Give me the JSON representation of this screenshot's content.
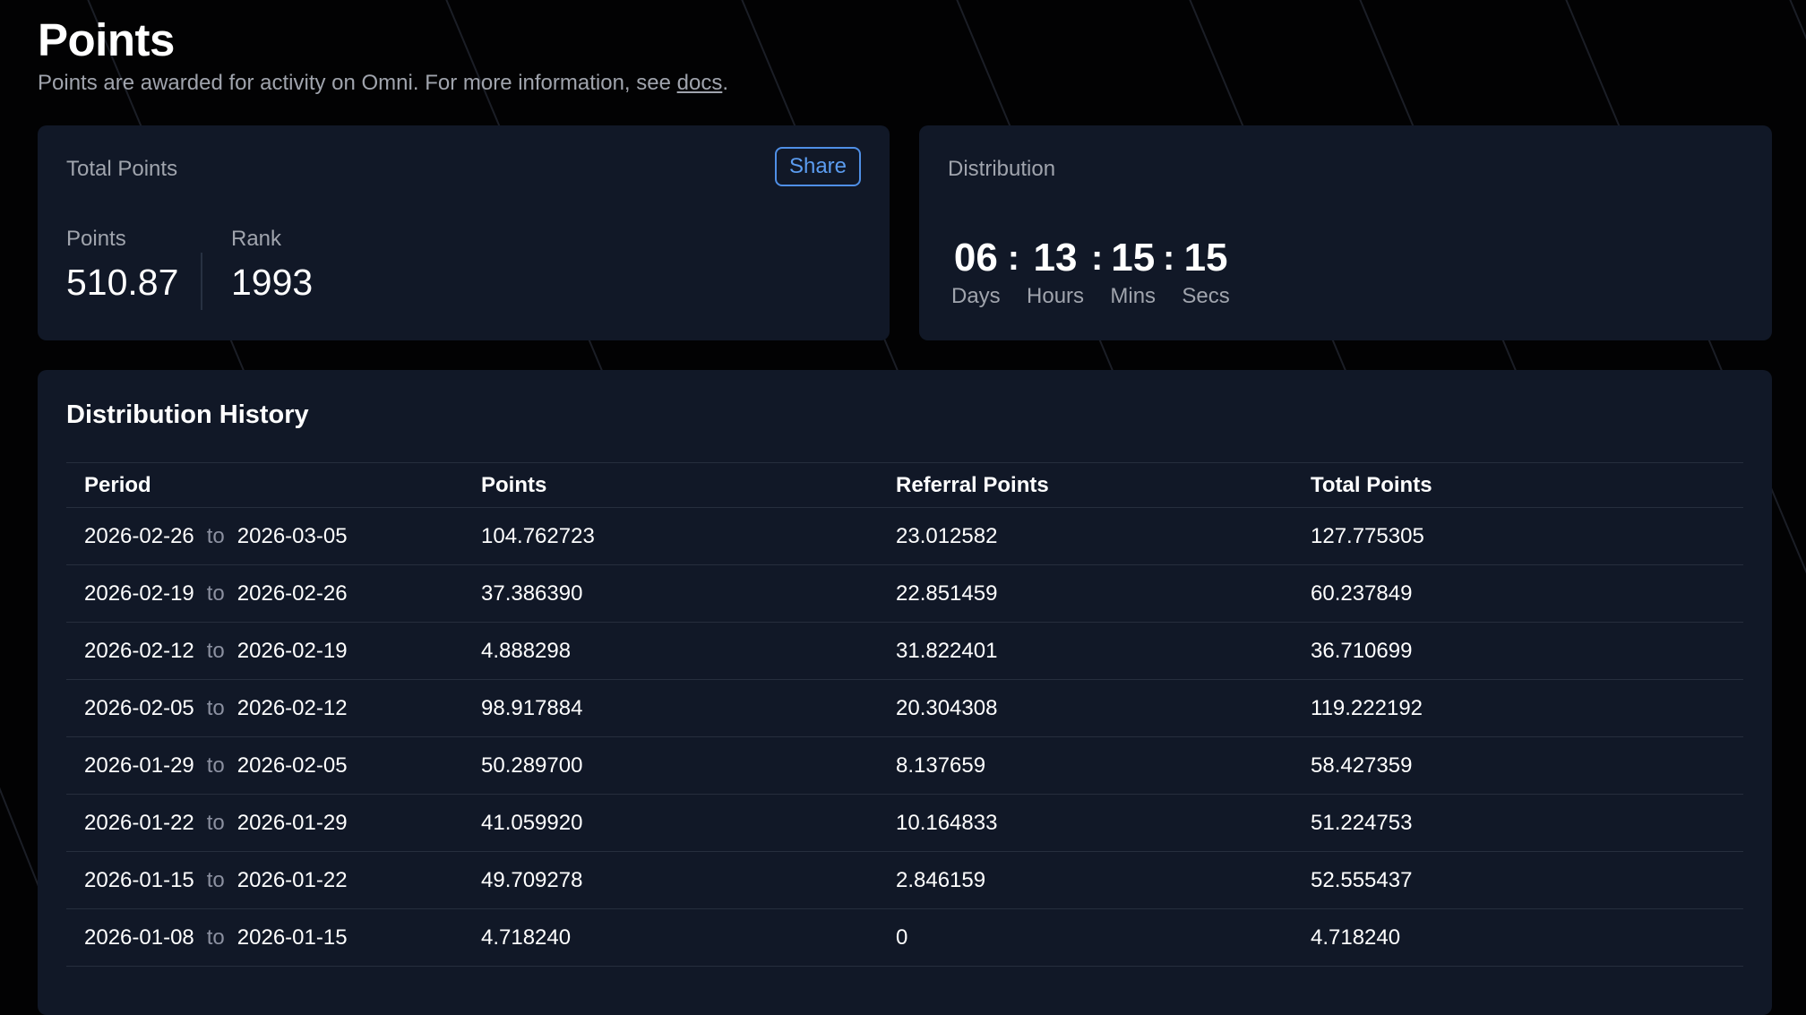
{
  "header": {
    "title": "Points",
    "subtitle_prefix": "Points are awarded for activity on Omni. For more information, see ",
    "docs_link": "docs",
    "subtitle_suffix": "."
  },
  "total_card": {
    "label": "Total Points",
    "share_label": "Share",
    "points_label": "Points",
    "points_value": "510.87",
    "rank_label": "Rank",
    "rank_value": "1993"
  },
  "distribution_card": {
    "label": "Distribution",
    "days": "06",
    "days_label": "Days",
    "hours": "13",
    "hours_label": "Hours",
    "mins": "15",
    "mins_label": "Mins",
    "secs": "15",
    "secs_label": "Secs",
    "separator": ":"
  },
  "history": {
    "title": "Distribution History",
    "columns": [
      "Period",
      "Points",
      "Referral Points",
      "Total Points"
    ],
    "to_label": "to",
    "rows": [
      {
        "start": "2026-02-26",
        "end": "2026-03-05",
        "points": "104.762723",
        "referral": "23.012582",
        "total": "127.775305"
      },
      {
        "start": "2026-02-19",
        "end": "2026-02-26",
        "points": "37.386390",
        "referral": "22.851459",
        "total": "60.237849"
      },
      {
        "start": "2026-02-12",
        "end": "2026-02-19",
        "points": "4.888298",
        "referral": "31.822401",
        "total": "36.710699"
      },
      {
        "start": "2026-02-05",
        "end": "2026-02-12",
        "points": "98.917884",
        "referral": "20.304308",
        "total": "119.222192"
      },
      {
        "start": "2026-01-29",
        "end": "2026-02-05",
        "points": "50.289700",
        "referral": "8.137659",
        "total": "58.427359"
      },
      {
        "start": "2026-01-22",
        "end": "2026-01-29",
        "points": "41.059920",
        "referral": "10.164833",
        "total": "51.224753"
      },
      {
        "start": "2026-01-15",
        "end": "2026-01-22",
        "points": "49.709278",
        "referral": "2.846159",
        "total": "52.555437"
      },
      {
        "start": "2026-01-08",
        "end": "2026-01-15",
        "points": "4.718240",
        "referral": "0",
        "total": "4.718240"
      }
    ]
  },
  "colors": {
    "background": "#020203",
    "card": "#111827",
    "accent": "#5b9cf0",
    "muted_text": "#a0a4ad"
  }
}
